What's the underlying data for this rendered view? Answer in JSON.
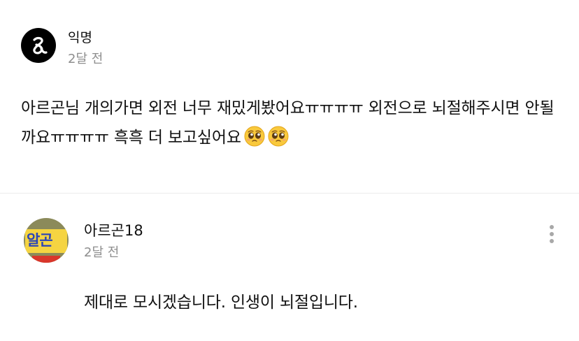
{
  "comment": {
    "author": "익명",
    "time": "2달 전",
    "text": "아르곤님 개의가면 외전 너무 재밌게봤어요ㅠㅠㅠㅠ 외전으로 뇌절해주시면 안될까요ㅠㅠㅠㅠ 흑흑 더 보고싶어요",
    "emojis": [
      "pleading-face-emoji",
      "pleading-face-emoji"
    ]
  },
  "reply": {
    "author": "아르곤18",
    "time": "2달 전",
    "avatar_text": "알곤",
    "text": "제대로 모시겠습니다. 인생이 뇌절입니다."
  },
  "icons": {
    "anon_avatar": "anonymous-logo-icon",
    "more": "vertical-ellipsis-icon"
  },
  "colors": {
    "text": "#111111",
    "muted": "#8e8e8e",
    "divider": "#ececec"
  }
}
